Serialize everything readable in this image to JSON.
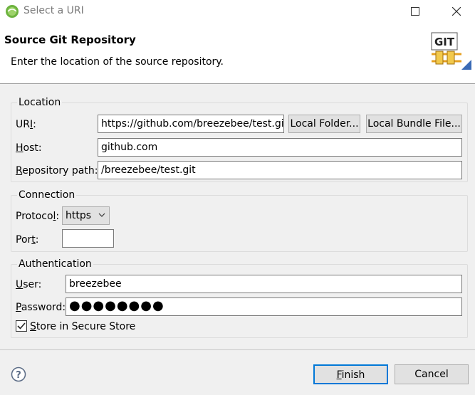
{
  "window": {
    "title": "Select a URI",
    "app_icon": "eclipse-icon",
    "maximize_icon": "maximize-icon",
    "close_icon": "close-icon"
  },
  "header": {
    "title": "Source Git Repository",
    "description": "Enter the location of the source repository.",
    "logo_text": "GIT"
  },
  "location": {
    "group_title": "Location",
    "uri_label_pre": "UR",
    "uri_label_mn": "I",
    "uri_label_post": ":",
    "uri_value": "https://github.com/breezebee/test.git",
    "local_folder_button": "Local Folder...",
    "local_bundle_button": "Local Bundle File...",
    "host_label_mn": "H",
    "host_label_post": "ost:",
    "host_value": "github.com",
    "repo_label_mn": "R",
    "repo_label_post": "epository path:",
    "repo_value": "/breezebee/test.git"
  },
  "connection": {
    "group_title": "Connection",
    "protocol_label_pre": "Protoco",
    "protocol_label_mn": "l",
    "protocol_label_post": ":",
    "protocol_value": "https",
    "port_label_pre": "Por",
    "port_label_mn": "t",
    "port_label_post": ":",
    "port_value": ""
  },
  "authentication": {
    "group_title": "Authentication",
    "user_label_mn": "U",
    "user_label_post": "ser:",
    "user_value": "breezebee",
    "password_label_mn": "P",
    "password_label_post": "assword:",
    "password_masked": "●●●●●●●●",
    "store_checkbox_checked": true,
    "store_label_mn": "S",
    "store_label_post": "tore in Secure Store"
  },
  "footer": {
    "help_icon": "help-icon",
    "finish_mn": "F",
    "finish_post": "inish",
    "cancel_label": "Cancel"
  },
  "colors": {
    "default_button_border": "#0078d7",
    "banner_background": "#ffffff",
    "dialog_background": "#f0f0f0"
  }
}
